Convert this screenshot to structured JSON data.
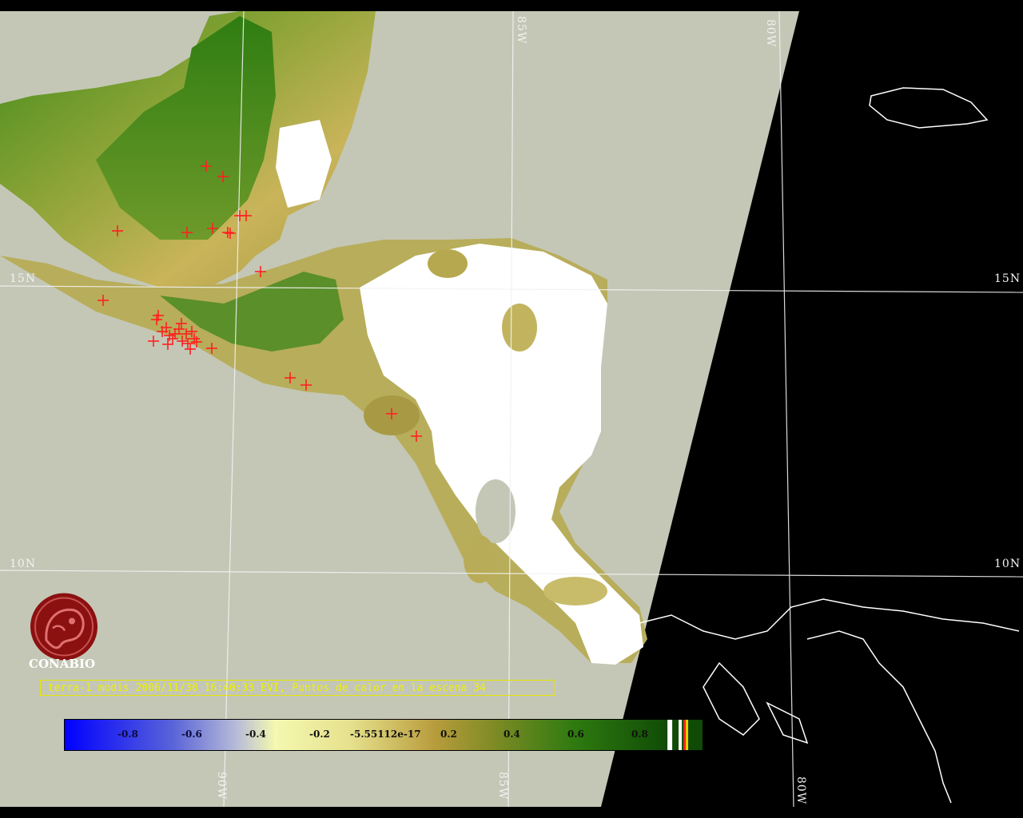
{
  "grid_labels": {
    "lat_15": "15N",
    "lat_10": "10N",
    "lon_85": "85W",
    "lon_80": "80W",
    "lon_90": "90W"
  },
  "logo_text": "CONABIO",
  "caption": "terra-1 modis 2006/11/30 16:40:33 EVI, Puntos de calor en la escena 34",
  "colorbar_ticks": [
    "-0.8",
    "-0.6",
    "-0.4",
    "-0.2",
    "-5.55112e-17",
    "0.2",
    "0.4",
    "0.6",
    "0.8"
  ],
  "colors": {
    "ocean": "#c4c7b6",
    "night": "#000000",
    "cloud": "#ffffff",
    "vegetation_low": "#c9b45a",
    "vegetation_high": "#2f7d12",
    "hotspot": "#ff2020",
    "caption": "#f0f000"
  },
  "hotspot_count": 34
}
